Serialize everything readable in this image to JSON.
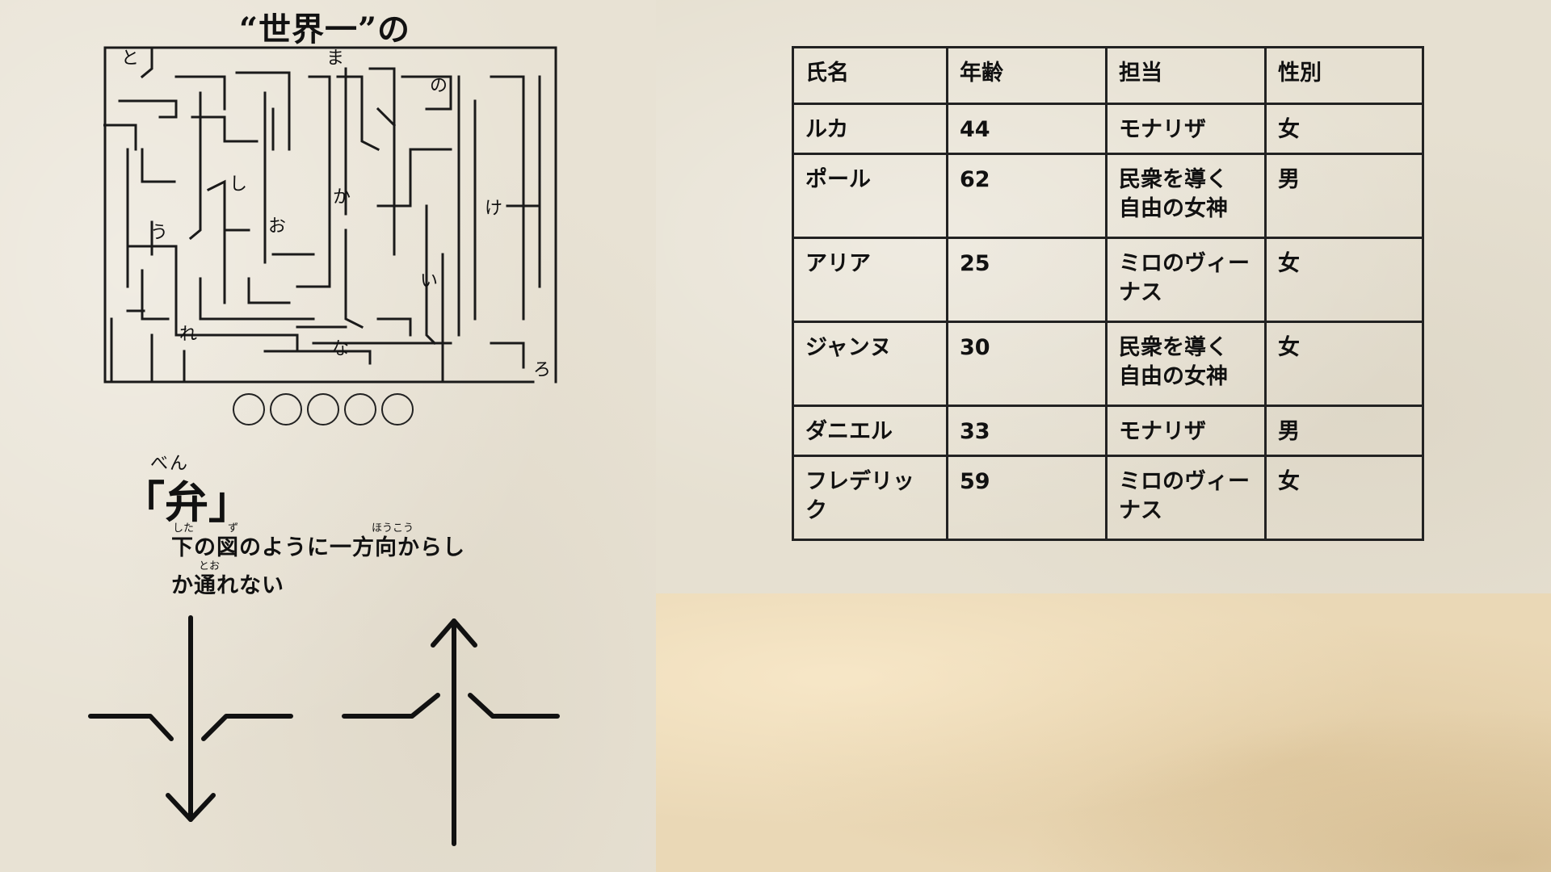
{
  "maze": {
    "title": "“世界一”の",
    "answer_slots": 5,
    "letters": [
      {
        "char": "と"
      },
      {
        "char": "ま"
      },
      {
        "char": "の"
      },
      {
        "char": "し"
      },
      {
        "char": "か"
      },
      {
        "char": "け"
      },
      {
        "char": "う"
      },
      {
        "char": "お"
      },
      {
        "char": "い"
      },
      {
        "char": "れ"
      },
      {
        "char": "な"
      },
      {
        "char": "ろ"
      }
    ]
  },
  "hint": {
    "ruby": "べん",
    "kanji": "「弁」",
    "ruby_shita": "した",
    "ruby_zu": "ず",
    "ruby_houkou": "ほうこう",
    "ruby_too": "とお",
    "line1": "下の図のように一方向からし",
    "line2": "か通れない"
  },
  "table": {
    "headers": [
      "氏名",
      "年齢",
      "担当",
      "性別"
    ],
    "rows": [
      [
        "ルカ",
        "44",
        "モナリザ",
        "女"
      ],
      [
        "ポール",
        "62",
        "民衆を導く\n自由の女神",
        "男"
      ],
      [
        "アリア",
        "25",
        "ミロのヴィー\nナス",
        "女"
      ],
      [
        "ジャンヌ",
        "30",
        "民衆を導く\n自由の女神",
        "女"
      ],
      [
        "ダニエル",
        "33",
        "モナリザ",
        "男"
      ],
      [
        "フレデリック",
        "59",
        "ミロのヴィー\nナス",
        "女"
      ]
    ]
  }
}
